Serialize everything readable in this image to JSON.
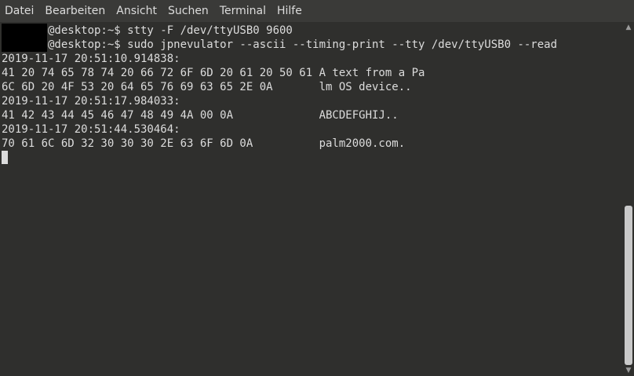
{
  "menubar": {
    "items": [
      "Datei",
      "Bearbeiten",
      "Ansicht",
      "Suchen",
      "Terminal",
      "Hilfe"
    ]
  },
  "terminal": {
    "lines": [
      "       @desktop:~$ stty -F /dev/ttyUSB0 9600",
      "       @desktop:~$ sudo jpnevulator --ascii --timing-print --tty /dev/ttyUSB0 --read",
      "2019-11-17 20:51:10.914838:",
      "41 20 74 65 78 74 20 66 72 6F 6D 20 61 20 50 61 A text from a Pa",
      "6C 6D 20 4F 53 20 64 65 76 69 63 65 2E 0A       lm OS device..",
      "2019-11-17 20:51:17.984033:",
      "41 42 43 44 45 46 47 48 49 4A 00 0A             ABCDEFGHIJ..",
      "2019-11-17 20:51:44.530464:",
      "70 61 6C 6D 32 30 30 30 2E 63 6F 6D 0A          palm2000.com."
    ],
    "cursor_visible": true
  },
  "scrollbar": {
    "up_arrow_icon": "chevron-up-icon",
    "down_arrow_icon": "chevron-down-icon",
    "thumb_start_fraction": 0.52,
    "thumb_end_fraction": 1.0
  },
  "colors": {
    "background": "#2f2f2d",
    "foreground": "#dcdcdc",
    "menubar": "#3a3a38",
    "redaction": "#000000"
  }
}
